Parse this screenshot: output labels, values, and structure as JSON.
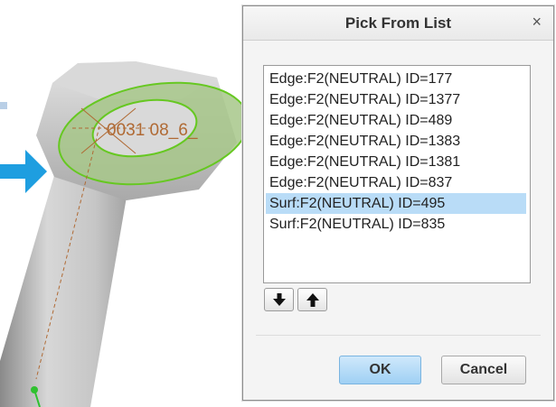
{
  "viewport": {
    "model_label": "0031 08_6_"
  },
  "dialog": {
    "title": "Pick From List",
    "close_label": "×",
    "items": [
      "Edge:F2(NEUTRAL) ID=177",
      "Edge:F2(NEUTRAL) ID=1377",
      "Edge:F2(NEUTRAL) ID=489",
      "Edge:F2(NEUTRAL) ID=1383",
      "Edge:F2(NEUTRAL) ID=1381",
      "Edge:F2(NEUTRAL) ID=837",
      "Surf:F2(NEUTRAL) ID=495",
      "Surf:F2(NEUTRAL) ID=835"
    ],
    "selected_index": 6,
    "ok_label": "OK",
    "cancel_label": "Cancel"
  },
  "colors": {
    "selection": "#b9dcf7",
    "highlight_green": "#66c821",
    "arrow_blue": "#1e9ee0",
    "model_gray": "#c4c4c4",
    "label_brown": "#b06a34"
  },
  "icons": {
    "down": "arrow-down-icon",
    "up": "arrow-up-icon"
  }
}
